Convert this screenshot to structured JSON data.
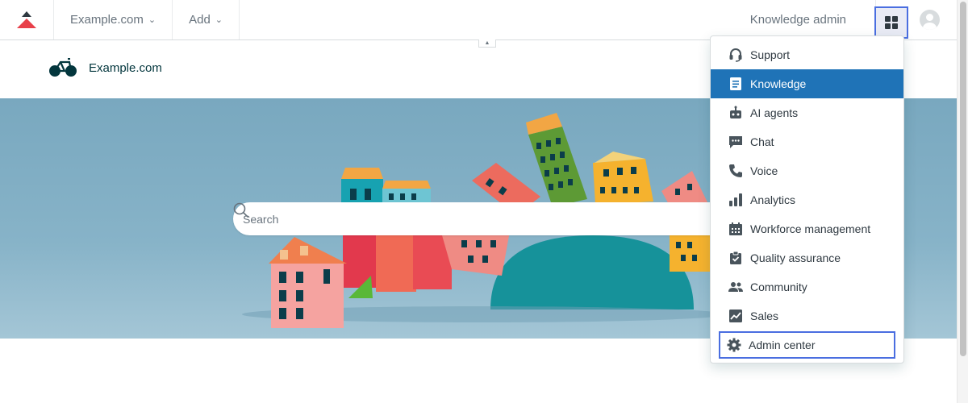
{
  "topbar": {
    "brand_menu_label": "Example.com",
    "add_label": "Add",
    "knowledge_admin_label": "Knowledge admin"
  },
  "brand": {
    "name": "Example.com"
  },
  "search": {
    "placeholder": "Search"
  },
  "menu": {
    "items": [
      {
        "label": "Support",
        "icon": "headset-icon"
      },
      {
        "label": "Knowledge",
        "icon": "book-icon",
        "active": true
      },
      {
        "label": "AI agents",
        "icon": "robot-icon"
      },
      {
        "label": "Chat",
        "icon": "chat-icon"
      },
      {
        "label": "Voice",
        "icon": "phone-icon"
      },
      {
        "label": "Analytics",
        "icon": "bar-chart-icon"
      },
      {
        "label": "Workforce management",
        "icon": "building-icon"
      },
      {
        "label": "Quality assurance",
        "icon": "clipboard-check-icon"
      },
      {
        "label": "Community",
        "icon": "people-icon"
      },
      {
        "label": "Sales",
        "icon": "trend-chart-icon"
      },
      {
        "label": "Admin center",
        "icon": "gear-icon",
        "highlighted": true
      }
    ]
  },
  "colors": {
    "active_item": "#1f73b7",
    "focus_outline": "#4a6ee0",
    "brand_logo_red": "#e8404a",
    "icon_gray": "#49545c"
  }
}
